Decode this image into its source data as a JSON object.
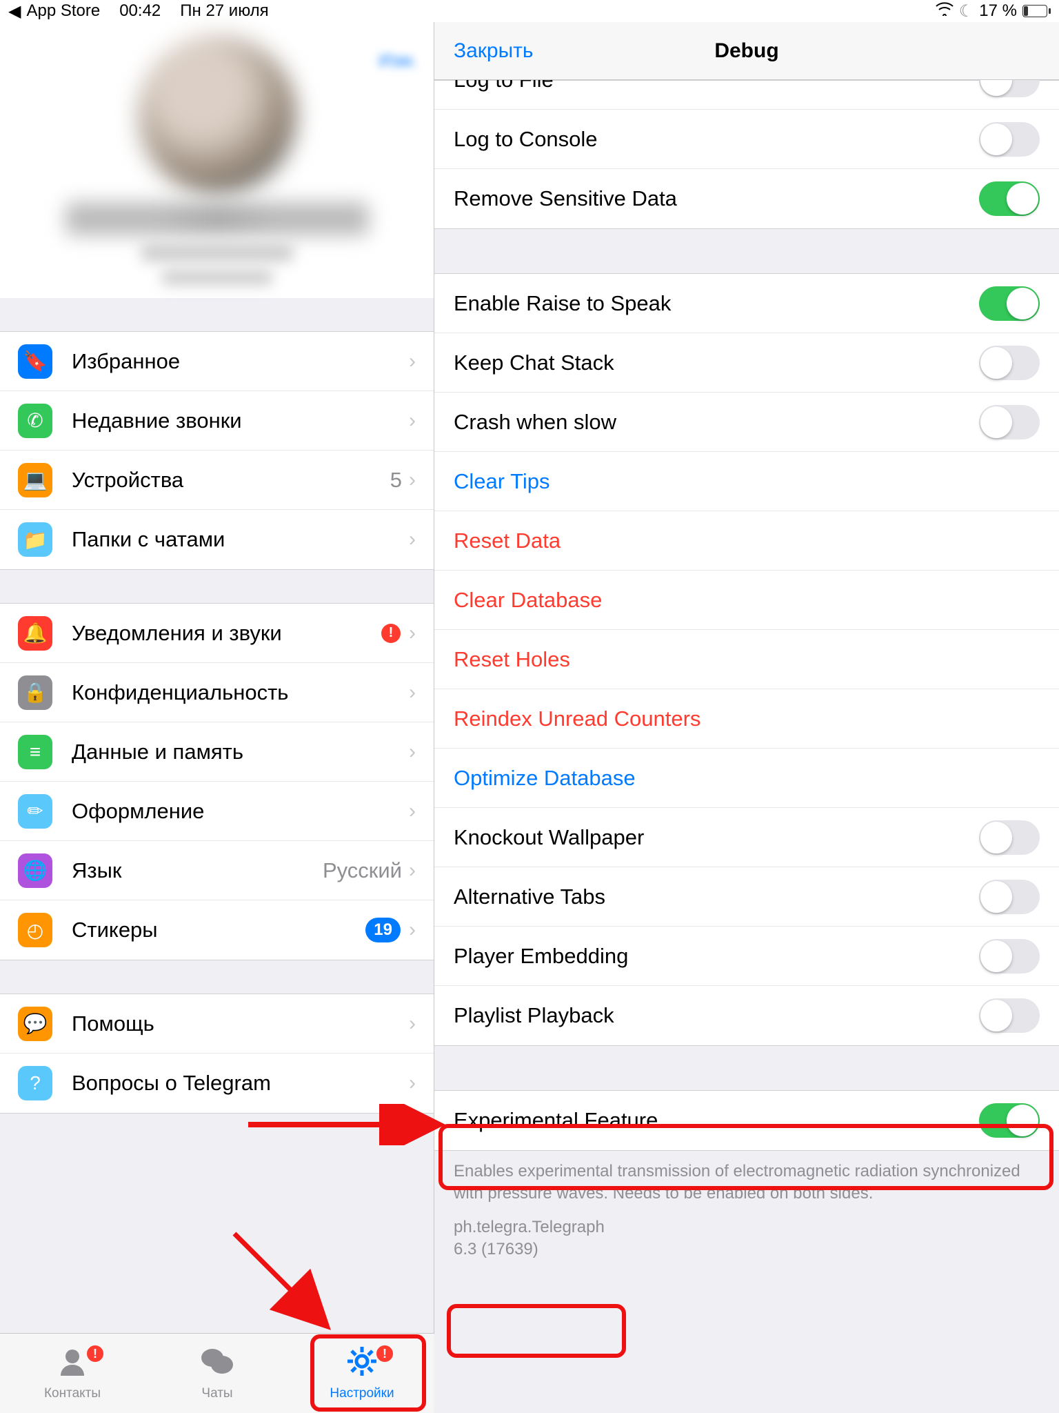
{
  "status": {
    "back_app": "App Store",
    "time": "00:42",
    "date": "Пн 27 июля",
    "battery_pct": "17 %"
  },
  "left": {
    "edit": "Изм.",
    "sections": [
      [
        {
          "icon": "bookmark",
          "bg": "ic-blue",
          "label": "Избранное"
        },
        {
          "icon": "phone",
          "bg": "ic-green",
          "label": "Недавние звонки"
        },
        {
          "icon": "laptop",
          "bg": "ic-orange",
          "label": "Устройства",
          "detail": "5"
        },
        {
          "icon": "folder",
          "bg": "ic-cyan",
          "label": "Папки с чатами"
        }
      ],
      [
        {
          "icon": "bell",
          "bg": "ic-red",
          "label": "Уведомления и звуки",
          "alert": "!"
        },
        {
          "icon": "lock",
          "bg": "ic-gray",
          "label": "Конфиденциальность"
        },
        {
          "icon": "db",
          "bg": "ic-green",
          "label": "Данные и память"
        },
        {
          "icon": "brush",
          "bg": "ic-cyan",
          "label": "Оформление"
        },
        {
          "icon": "globe",
          "bg": "ic-purple",
          "label": "Язык",
          "detail": "Русский"
        },
        {
          "icon": "sticker",
          "bg": "ic-orange",
          "label": "Стикеры",
          "badge": "19"
        }
      ],
      [
        {
          "icon": "chat",
          "bg": "ic-orange",
          "label": "Помощь"
        },
        {
          "icon": "question",
          "bg": "ic-cyan",
          "label": "Вопросы о Telegram"
        }
      ]
    ],
    "tabs": {
      "contacts": "Контакты",
      "chats": "Чаты",
      "settings": "Настройки"
    }
  },
  "right": {
    "close": "Закрыть",
    "title": "Debug",
    "groups": [
      {
        "rows": [
          {
            "label": "Log to File",
            "type": "switch",
            "on": false,
            "cut": true
          },
          {
            "label": "Log to Console",
            "type": "switch",
            "on": false
          },
          {
            "label": "Remove Sensitive Data",
            "type": "switch",
            "on": true
          }
        ]
      },
      {
        "rows": [
          {
            "label": "Enable Raise to Speak",
            "type": "switch",
            "on": true
          },
          {
            "label": "Keep Chat Stack",
            "type": "switch",
            "on": false
          },
          {
            "label": "Crash when slow",
            "type": "switch",
            "on": false
          },
          {
            "label": "Clear Tips",
            "type": "link",
            "color": "blue"
          },
          {
            "label": "Reset Data",
            "type": "link",
            "color": "red"
          },
          {
            "label": "Clear Database",
            "type": "link",
            "color": "red"
          },
          {
            "label": "Reset Holes",
            "type": "link",
            "color": "red"
          },
          {
            "label": "Reindex Unread Counters",
            "type": "link",
            "color": "red"
          },
          {
            "label": "Optimize Database",
            "type": "link",
            "color": "blue"
          },
          {
            "label": "Knockout Wallpaper",
            "type": "switch",
            "on": false
          },
          {
            "label": "Alternative Tabs",
            "type": "switch",
            "on": false
          },
          {
            "label": "Player Embedding",
            "type": "switch",
            "on": false
          },
          {
            "label": "Playlist Playback",
            "type": "switch",
            "on": false
          }
        ]
      },
      {
        "rows": [
          {
            "label": "Experimental Feature",
            "type": "switch",
            "on": true
          }
        ],
        "footer": "Enables experimental transmission of electromagnetic radiation synchronized with pressure waves. Needs to be enabled on both sides."
      }
    ],
    "version_line1": "ph.telegra.Telegraph",
    "version_line2": "6.3 (17639)"
  },
  "icon_glyphs": {
    "bookmark": "🔖",
    "phone": "✆",
    "laptop": "💻",
    "folder": "📁",
    "bell": "🔔",
    "lock": "🔒",
    "db": "≡",
    "brush": "✏︎",
    "globe": "🌐",
    "sticker": "◴",
    "chat": "💬",
    "question": "?"
  }
}
